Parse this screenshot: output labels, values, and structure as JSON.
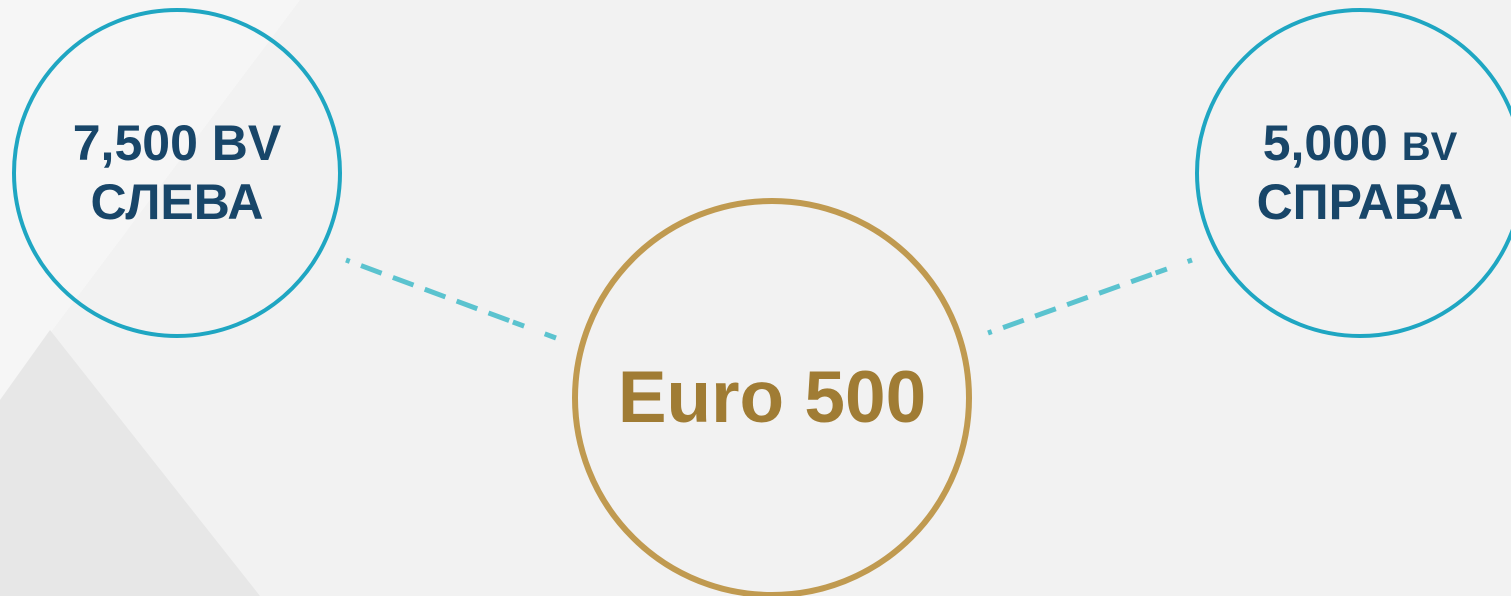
{
  "colors": {
    "background": "#f2f2f2",
    "side_circle_border": "#1fa6c2",
    "side_text": "#184669",
    "center_circle_border": "#c09a50",
    "center_text": "#a07c34",
    "connector": "#5bc3cf"
  },
  "left_node": {
    "amount": "7,500",
    "unit": "BV",
    "side": "СЛЕВА"
  },
  "right_node": {
    "amount": "5,000",
    "unit": "BV",
    "side": "СПРАВА"
  },
  "center_node": {
    "label": "Euro 500"
  }
}
